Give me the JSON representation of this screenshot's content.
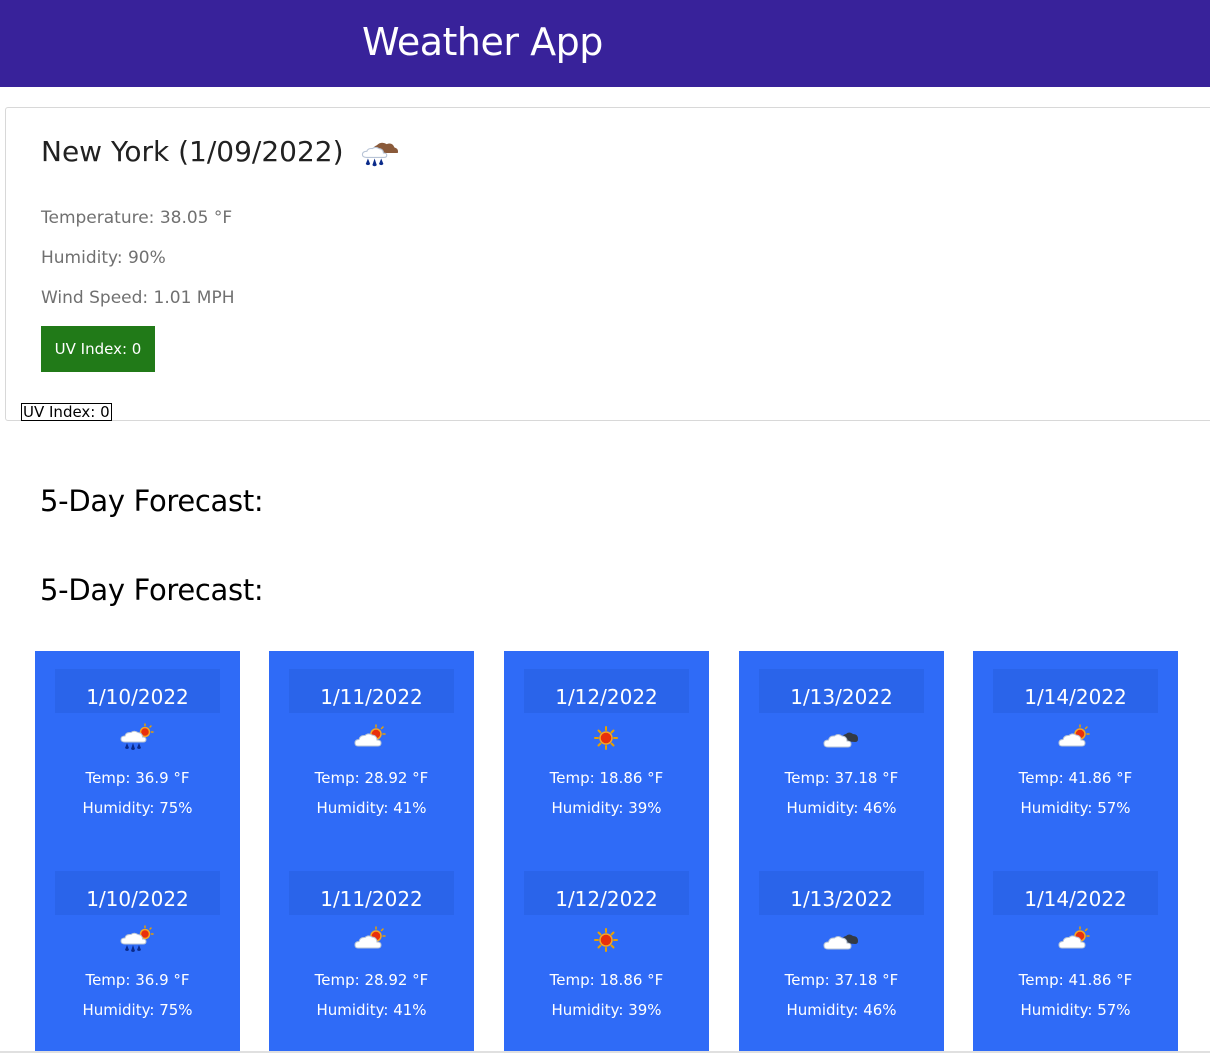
{
  "header": {
    "title": "Weather App",
    "background_color": "#38229a"
  },
  "current": {
    "city_heading": "New York (1/09/2022)",
    "icon": "rain-cloud-icon",
    "temperature": "Temperature: 38.05 °F",
    "humidity": "Humidity: 90%",
    "wind": "Wind Speed: 1.01 MPH",
    "uv_button_label": "UV Index: 0",
    "uv_button_color": "#217a18",
    "uv_plain_label": "UV Index: 0"
  },
  "forecast_headings": [
    "5-Day Forecast:",
    "5-Day Forecast:"
  ],
  "forecast_card_color": "#2f6bf7",
  "forecast": [
    {
      "days": [
        {
          "date": "1/10/2022",
          "icon": "rain-sun-icon",
          "temp": "Temp: 36.9 °F",
          "humidity": "Humidity: 75%"
        },
        {
          "date": "1/10/2022",
          "icon": "rain-sun-icon",
          "temp": "Temp: 36.9 °F",
          "humidity": "Humidity: 75%"
        }
      ]
    },
    {
      "days": [
        {
          "date": "1/11/2022",
          "icon": "partly-cloudy-icon",
          "temp": "Temp: 28.92 °F",
          "humidity": "Humidity: 41%"
        },
        {
          "date": "1/11/2022",
          "icon": "partly-cloudy-icon",
          "temp": "Temp: 28.92 °F",
          "humidity": "Humidity: 41%"
        }
      ]
    },
    {
      "days": [
        {
          "date": "1/12/2022",
          "icon": "sun-icon",
          "temp": "Temp: 18.86 °F",
          "humidity": "Humidity: 39%"
        },
        {
          "date": "1/12/2022",
          "icon": "sun-icon",
          "temp": "Temp: 18.86 °F",
          "humidity": "Humidity: 39%"
        }
      ]
    },
    {
      "days": [
        {
          "date": "1/13/2022",
          "icon": "cloudy-icon",
          "temp": "Temp: 37.18 °F",
          "humidity": "Humidity: 46%"
        },
        {
          "date": "1/13/2022",
          "icon": "cloudy-icon",
          "temp": "Temp: 37.18 °F",
          "humidity": "Humidity: 46%"
        }
      ]
    },
    {
      "days": [
        {
          "date": "1/14/2022",
          "icon": "partly-cloudy-icon",
          "temp": "Temp: 41.86 °F",
          "humidity": "Humidity: 57%"
        },
        {
          "date": "1/14/2022",
          "icon": "partly-cloudy-icon",
          "temp": "Temp: 41.86 °F",
          "humidity": "Humidity: 57%"
        }
      ]
    }
  ]
}
